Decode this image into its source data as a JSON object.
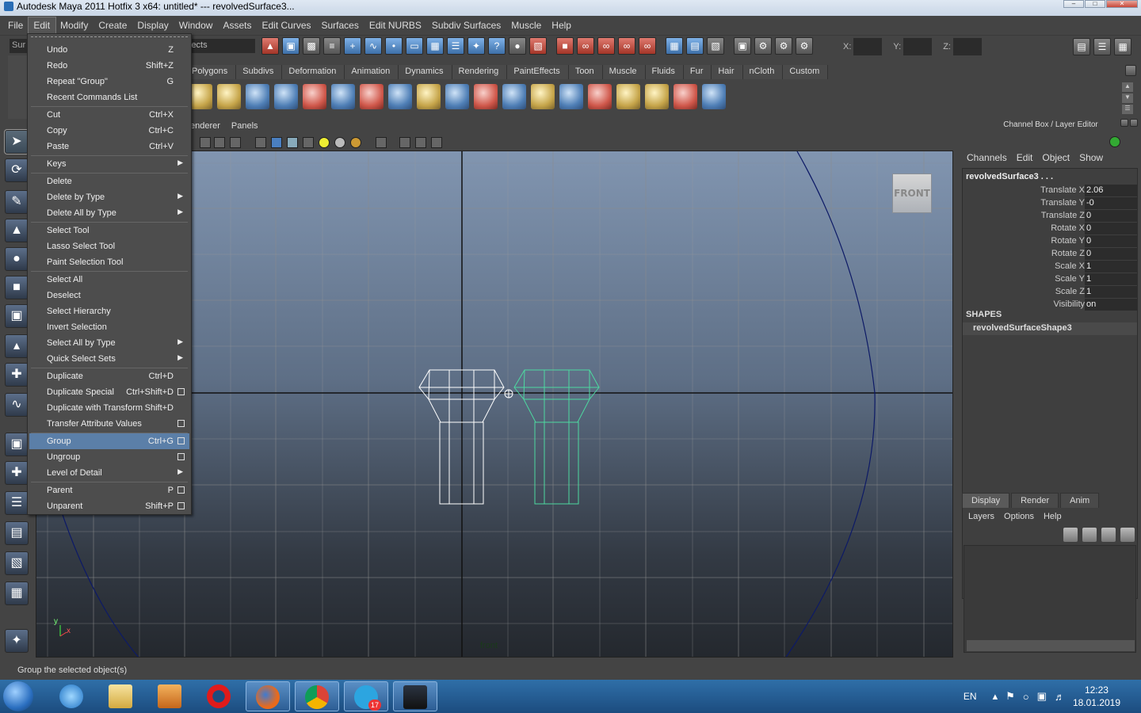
{
  "window": {
    "title": "Autodesk Maya 2011 Hotfix 3 x64: untitled*   ---   revolvedSurface3..."
  },
  "menubar": [
    "File",
    "Edit",
    "Modify",
    "Create",
    "Display",
    "Window",
    "Assets",
    "Edit Curves",
    "Surfaces",
    "Edit NURBS",
    "Subdiv Surfaces",
    "Muscle",
    "Help"
  ],
  "status": {
    "mode_field": "Sur",
    "select_field": "jects",
    "x_label": "X:",
    "y_label": "Y:",
    "z_label": "Z:"
  },
  "shelf_tabs": [
    "Polygons",
    "Subdivs",
    "Deformation",
    "Animation",
    "Dynamics",
    "Rendering",
    "PaintEffects",
    "Toon",
    "Muscle",
    "Fluids",
    "Fur",
    "Hair",
    "nCloth",
    "Custom"
  ],
  "viewport": {
    "menu": [
      "enderer",
      "Panels"
    ],
    "view_cube_label": "FRONT",
    "camera_label": "front",
    "axis_y": "y",
    "axis_x": "x"
  },
  "channel_box": {
    "title": "Channel Box / Layer Editor",
    "menu": [
      "Channels",
      "Edit",
      "Object",
      "Show"
    ],
    "object_name": "revolvedSurface3 . . .",
    "attributes": [
      {
        "name": "Translate X",
        "value": "2.06"
      },
      {
        "name": "Translate Y",
        "value": "-0"
      },
      {
        "name": "Translate Z",
        "value": "0"
      },
      {
        "name": "Rotate X",
        "value": "0"
      },
      {
        "name": "Rotate Y",
        "value": "0"
      },
      {
        "name": "Rotate Z",
        "value": "0"
      },
      {
        "name": "Scale X",
        "value": "1"
      },
      {
        "name": "Scale Y",
        "value": "1"
      },
      {
        "name": "Scale Z",
        "value": "1"
      },
      {
        "name": "Visibility",
        "value": "on"
      }
    ],
    "shapes_header": "SHAPES",
    "shape_name": "revolvedSurfaceShape3"
  },
  "layer_editor": {
    "tabs": [
      "Display",
      "Render",
      "Anim"
    ],
    "menu": [
      "Layers",
      "Options",
      "Help"
    ]
  },
  "help_line": "Group the selected object(s)",
  "edit_menu": [
    {
      "label": "Undo",
      "shortcut": "Z"
    },
    {
      "label": "Redo",
      "shortcut": "Shift+Z"
    },
    {
      "label": "Repeat \"Group\"",
      "shortcut": "G"
    },
    {
      "label": "Recent Commands List",
      "shortcut": ""
    },
    {
      "label": "Cut",
      "shortcut": "Ctrl+X"
    },
    {
      "label": "Copy",
      "shortcut": "Ctrl+C"
    },
    {
      "label": "Paste",
      "shortcut": "Ctrl+V"
    },
    {
      "label": "Keys",
      "shortcut": "",
      "submenu": true
    },
    {
      "label": "Delete",
      "shortcut": ""
    },
    {
      "label": "Delete by Type",
      "shortcut": "",
      "submenu": true
    },
    {
      "label": "Delete All by Type",
      "shortcut": "",
      "submenu": true
    },
    {
      "label": "Select Tool",
      "shortcut": ""
    },
    {
      "label": "Lasso Select Tool",
      "shortcut": ""
    },
    {
      "label": "Paint Selection Tool",
      "shortcut": ""
    },
    {
      "label": "Select All",
      "shortcut": ""
    },
    {
      "label": "Deselect",
      "shortcut": ""
    },
    {
      "label": "Select Hierarchy",
      "shortcut": ""
    },
    {
      "label": "Invert Selection",
      "shortcut": ""
    },
    {
      "label": "Select All by Type",
      "shortcut": "",
      "submenu": true
    },
    {
      "label": "Quick Select Sets",
      "shortcut": "",
      "submenu": true
    },
    {
      "label": "Duplicate",
      "shortcut": "Ctrl+D"
    },
    {
      "label": "Duplicate Special",
      "shortcut": "Ctrl+Shift+D",
      "option": true
    },
    {
      "label": "Duplicate with Transform",
      "shortcut": "Shift+D"
    },
    {
      "label": "Transfer Attribute Values",
      "shortcut": "",
      "option": true
    },
    {
      "label": "Group",
      "shortcut": "Ctrl+G",
      "option": true,
      "highlighted": true
    },
    {
      "label": "Ungroup",
      "shortcut": "",
      "option": true
    },
    {
      "label": "Level of Detail",
      "shortcut": "",
      "submenu": true
    },
    {
      "label": "Parent",
      "shortcut": "P",
      "option": true
    },
    {
      "label": "Unparent",
      "shortcut": "Shift+P",
      "option": true
    }
  ],
  "taskbar": {
    "apps": [
      "internet-explorer",
      "file-explorer",
      "media-player",
      "opera",
      "firefox",
      "chrome",
      "telegram",
      "maya"
    ],
    "telegram_badge": "17",
    "language": "EN",
    "time": "12:23",
    "date": "18.01.2019"
  }
}
